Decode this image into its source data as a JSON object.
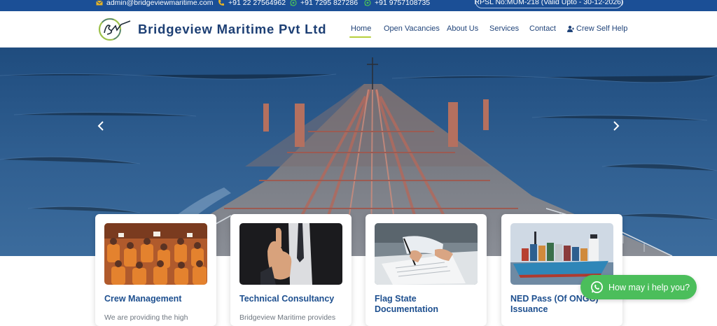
{
  "topbar": {
    "email": "admin@bridgeviewmaritime.com",
    "phone": "+91 22 27564962",
    "whatsapp_1": "+91 7295 827286",
    "whatsapp_2": "+91 9757108735",
    "rpsl": "RPSL No:MUM-218 (Valid Upto - 30-12-2026)"
  },
  "header": {
    "brand": "Bridgeview Maritime Pvt Ltd",
    "nav": [
      "Home",
      "Open Vacancies",
      "About Us",
      "Services",
      "Contact",
      "Crew Self Help"
    ],
    "active_nav": "Home"
  },
  "cards": [
    {
      "title": "Crew Management",
      "desc": "We are providing the high"
    },
    {
      "title": "Technical Consultancy",
      "desc": "Bridgeview Maritime provides"
    },
    {
      "title": "Flag State Documentation",
      "desc": ""
    },
    {
      "title": "NED Pass (Of ONGC) Issuance",
      "desc": ""
    }
  ],
  "chat": {
    "label": "How may i help you?"
  },
  "icons": {
    "email": "envelope-icon",
    "phone": "phone-icon",
    "whatsapp": "whatsapp-icon",
    "crew": "user-icon",
    "prev": "chevron-left-icon",
    "next": "chevron-right-icon"
  },
  "colors": {
    "topbar": "#1b4f96",
    "brand_text": "#1d3f74",
    "nav_active_underline": "#b7cf3b",
    "card_title": "#1d4f8f",
    "chat_bubble": "#4bbe5b",
    "email_icon": "#e6b325",
    "phone_icon": "#e6b325",
    "whatsapp_icon": "#4bbe5b"
  }
}
